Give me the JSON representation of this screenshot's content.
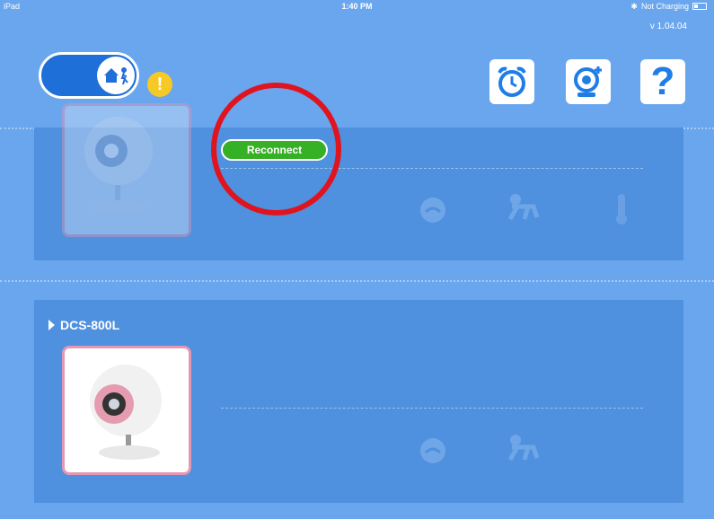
{
  "status_bar": {
    "device": "iPad",
    "time": "1:40 PM",
    "battery_text": "Not Charging"
  },
  "app": {
    "version": "v 1.04.04"
  },
  "header": {
    "mode_toggle": {
      "icon": "home-person-icon",
      "state": "home"
    },
    "alert_badge": "!",
    "buttons": [
      {
        "name": "alarm",
        "icon": "alarm-clock-icon"
      },
      {
        "name": "add-camera",
        "icon": "add-camera-icon"
      },
      {
        "name": "help",
        "icon": "question-icon",
        "glyph": "?"
      }
    ]
  },
  "cameras": [
    {
      "name": "",
      "status": "disconnected",
      "action_label": "Reconnect",
      "icons": [
        "crying-face-icon",
        "crawling-baby-icon",
        "thermometer-icon"
      ]
    },
    {
      "name": "DCS-800L",
      "status": "connected",
      "icons": [
        "crying-face-icon",
        "crawling-baby-icon"
      ]
    }
  ],
  "colors": {
    "background": "#6aa6ee",
    "card": "#4f90df",
    "accent_green": "#36b024",
    "highlight_red": "#e0141e",
    "thumbnail_border": "#e596b5"
  }
}
